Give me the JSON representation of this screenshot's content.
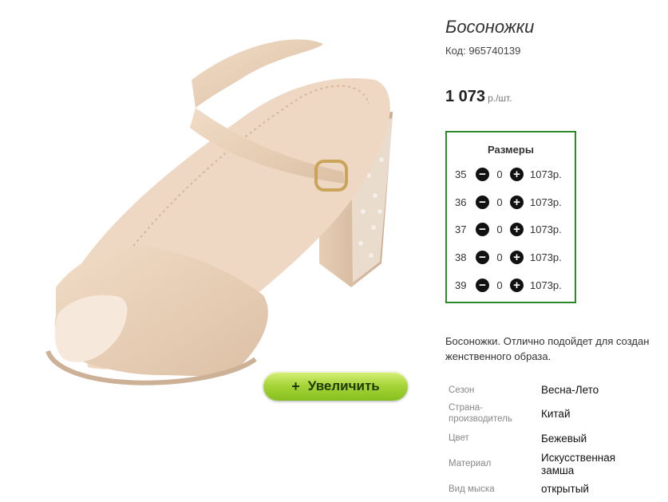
{
  "product": {
    "title": "Босоножки",
    "code_label": "Код: 965740139",
    "price_amount": "1 073",
    "price_unit": "р./шт."
  },
  "zoom_button": {
    "plus": "+",
    "label": "Увеличить"
  },
  "sizes": {
    "title": "Размеры",
    "rows": [
      {
        "size": "35",
        "qty": "0",
        "price": "1073р."
      },
      {
        "size": "36",
        "qty": "0",
        "price": "1073р."
      },
      {
        "size": "37",
        "qty": "0",
        "price": "1073р."
      },
      {
        "size": "38",
        "qty": "0",
        "price": "1073р."
      },
      {
        "size": "39",
        "qty": "0",
        "price": "1073р."
      }
    ]
  },
  "description": {
    "line1": "Босоножки. Отлично подойдет для создан",
    "line2": "женственного образа."
  },
  "properties": [
    {
      "label_lines": [
        "Сезон"
      ],
      "value_lines": [
        "Весна-Лето"
      ]
    },
    {
      "label_lines": [
        "Страна-",
        "производитель"
      ],
      "value_lines": [
        "Китай"
      ]
    },
    {
      "label_lines": [
        "Цвет"
      ],
      "value_lines": [
        "Бежевый"
      ]
    },
    {
      "label_lines": [
        "Материал"
      ],
      "value_lines": [
        "Искусственная",
        "замша"
      ]
    },
    {
      "label_lines": [
        "Вид мыска"
      ],
      "value_lines": [
        "открытый"
      ]
    }
  ]
}
